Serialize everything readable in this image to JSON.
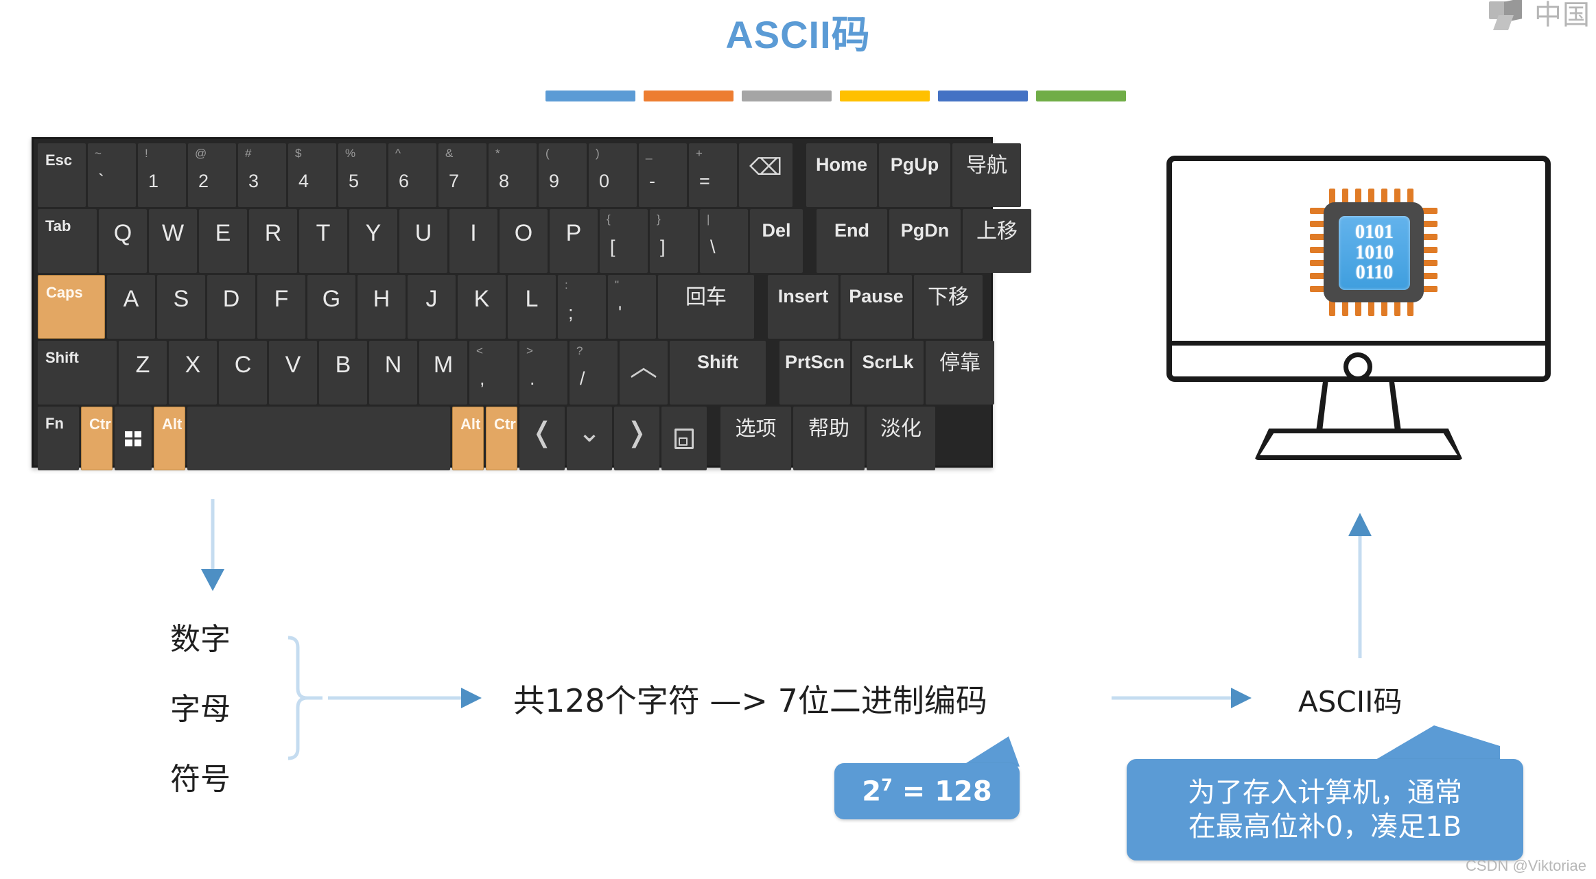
{
  "corp_logo": {
    "text": "中国"
  },
  "title": "ASCII码",
  "title_rule_colors": [
    "#5b9bd5",
    "#ed7d31",
    "#a5a5a5",
    "#ffc000",
    "#4472c4",
    "#70ad47"
  ],
  "keyboard": {
    "rows": [
      {
        "name": "number-row",
        "keys": [
          {
            "label": "Esc",
            "style": "lbl small"
          },
          {
            "top": "~",
            "sub": "`"
          },
          {
            "top": "!",
            "sub": "1"
          },
          {
            "top": "@",
            "sub": "2"
          },
          {
            "top": "#",
            "sub": "3"
          },
          {
            "top": "$",
            "sub": "4"
          },
          {
            "top": "%",
            "sub": "5"
          },
          {
            "top": "^",
            "sub": "6"
          },
          {
            "top": "&",
            "sub": "7"
          },
          {
            "top": "*",
            "sub": "8"
          },
          {
            "top": "(",
            "sub": "9"
          },
          {
            "top": ")",
            "sub": "0"
          },
          {
            "top": "_",
            "sub": "-"
          },
          {
            "top": "+",
            "sub": "="
          },
          {
            "center": "⌫"
          },
          {
            "center": "Home"
          },
          {
            "center": "PgUp"
          },
          {
            "center": "导航"
          }
        ]
      },
      {
        "name": "qwerty-row",
        "keys": [
          {
            "label": "Tab",
            "style": "lbl small"
          },
          {
            "center": "Q"
          },
          {
            "center": "W"
          },
          {
            "center": "E"
          },
          {
            "center": "R"
          },
          {
            "center": "T"
          },
          {
            "center": "Y"
          },
          {
            "center": "U"
          },
          {
            "center": "I"
          },
          {
            "center": "O"
          },
          {
            "center": "P"
          },
          {
            "top": "{",
            "sub": "["
          },
          {
            "top": "}",
            "sub": "]"
          },
          {
            "top": "|",
            "sub": "\\"
          },
          {
            "center": "Del"
          },
          {
            "center": "End"
          },
          {
            "center": "PgDn"
          },
          {
            "center": "上移"
          }
        ]
      },
      {
        "name": "home-row",
        "keys": [
          {
            "label": "Caps",
            "style": "lbl small",
            "orange": true
          },
          {
            "center": "A"
          },
          {
            "center": "S"
          },
          {
            "center": "D"
          },
          {
            "center": "F"
          },
          {
            "center": "G"
          },
          {
            "center": "H"
          },
          {
            "center": "J"
          },
          {
            "center": "K"
          },
          {
            "center": "L"
          },
          {
            "top": ":",
            "sub": ";"
          },
          {
            "top": "\"",
            "sub": "'"
          },
          {
            "center": "回车"
          },
          {
            "center": "Insert"
          },
          {
            "center": "Pause"
          },
          {
            "center": "下移"
          }
        ]
      },
      {
        "name": "shift-row",
        "keys": [
          {
            "label": "Shift",
            "style": "lbl small"
          },
          {
            "center": "Z"
          },
          {
            "center": "X"
          },
          {
            "center": "C"
          },
          {
            "center": "V"
          },
          {
            "center": "B"
          },
          {
            "center": "N"
          },
          {
            "center": "M"
          },
          {
            "top": "<",
            "sub": ","
          },
          {
            "top": ">",
            "sub": "."
          },
          {
            "top": "?",
            "sub": "/"
          },
          {
            "center": "︿"
          },
          {
            "center": "Shift"
          },
          {
            "center": "PrtScn"
          },
          {
            "center": "ScrLk"
          },
          {
            "center": "停靠"
          }
        ]
      },
      {
        "name": "modifier-row",
        "keys": [
          {
            "label": "Fn",
            "style": "lbl small"
          },
          {
            "label": "Ctrl",
            "style": "lbl small",
            "orange": true
          },
          {
            "icon": "windows-icon"
          },
          {
            "label": "Alt",
            "style": "lbl small",
            "orange": true
          },
          {
            "label": "",
            "style": "spacebar"
          },
          {
            "label": "Alt",
            "style": "lbl small",
            "orange": true
          },
          {
            "label": "Ctrl",
            "style": "lbl small",
            "orange": true
          },
          {
            "center": "❬"
          },
          {
            "center": "⌄"
          },
          {
            "center": "❭"
          },
          {
            "icon": "app-menu-icon"
          },
          {
            "center": "选项"
          },
          {
            "center": "帮助"
          },
          {
            "center": "淡化"
          }
        ]
      }
    ]
  },
  "monitor": {
    "chip_lines": [
      "0101",
      "1010",
      "0110"
    ],
    "chip_pin_color": "#e07b26",
    "chip_core_color": "#4a9fdd"
  },
  "flow": {
    "group_items": [
      "数字",
      "字母",
      "符号"
    ],
    "center_text": "共128个字符   —>   7位二进制编码",
    "output_label": "ASCII码"
  },
  "callouts": {
    "power": {
      "base": "2",
      "exp": "7",
      "rest": "= 128"
    },
    "note_line1": "为了存入计算机，通常",
    "note_line2": "在最高位补0，凑足1B"
  },
  "watermark": "CSDN @Viktoriae"
}
